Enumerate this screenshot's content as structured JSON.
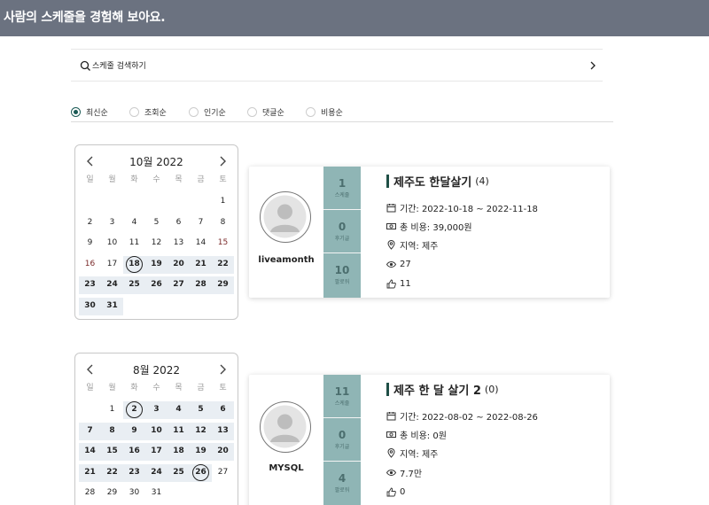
{
  "header": {
    "title": "사람의 스케줄을 경험해 보아요."
  },
  "search": {
    "placeholder": "스케줄 검색하기"
  },
  "sort_options": [
    {
      "label": "최신순",
      "selected": true
    },
    {
      "label": "조회순",
      "selected": false
    },
    {
      "label": "인기순",
      "selected": false
    },
    {
      "label": "댓글순",
      "selected": false
    },
    {
      "label": "비용순",
      "selected": false
    }
  ],
  "weekdays": [
    "일",
    "월",
    "화",
    "수",
    "목",
    "금",
    "토"
  ],
  "schedules": [
    {
      "calendar": {
        "title": "10월 2022",
        "rows": [
          [
            "",
            "",
            "",
            "",
            "",
            "",
            "1"
          ],
          [
            "2",
            "3",
            "4",
            "5",
            "6",
            "7",
            "8"
          ],
          [
            "9",
            "10",
            "11",
            "12",
            "13",
            "14",
            "15"
          ],
          [
            "16",
            "17",
            "18",
            "19",
            "20",
            "21",
            "22"
          ],
          [
            "23",
            "24",
            "25",
            "26",
            "27",
            "28",
            "29"
          ],
          [
            "30",
            "31",
            "",
            "",
            "",
            "",
            ""
          ]
        ],
        "circled": [
          "18"
        ]
      },
      "user": "liveamonth",
      "stats": [
        {
          "value": "1",
          "label": "스케줄"
        },
        {
          "value": "0",
          "label": "후기글"
        },
        {
          "value": "10",
          "label": "팔로워"
        }
      ],
      "title": "제주도 한달살기",
      "count": "(4)",
      "period": "기간: 2022-10-18 ~ 2022-11-18",
      "cost": "총 비용: 39,000원",
      "region": "지역: 제주",
      "views": "27",
      "likes": "11"
    },
    {
      "calendar": {
        "title": "8월 2022",
        "rows": [
          [
            "",
            "1",
            "2",
            "3",
            "4",
            "5",
            "6"
          ],
          [
            "7",
            "8",
            "9",
            "10",
            "11",
            "12",
            "13"
          ],
          [
            "14",
            "15",
            "16",
            "17",
            "18",
            "19",
            "20"
          ],
          [
            "21",
            "22",
            "23",
            "24",
            "25",
            "26",
            "27"
          ],
          [
            "28",
            "29",
            "30",
            "31",
            "",
            "",
            ""
          ]
        ],
        "circled": [
          "2",
          "26"
        ]
      },
      "user": "MYSQL",
      "stats": [
        {
          "value": "11",
          "label": "스케줄"
        },
        {
          "value": "0",
          "label": "후기글"
        },
        {
          "value": "4",
          "label": "팔로워"
        }
      ],
      "title": "제주 한 달 살기 2",
      "count": "(0)",
      "period": "기간: 2022-08-02 ~ 2022-08-26",
      "cost": "총 비용: 0원",
      "region": "지역: 제주",
      "views": "7.7만",
      "likes": "0"
    }
  ],
  "colors": {
    "header_bg": "#6b7280",
    "stats_bg": "#8fb5b5",
    "accent": "#1a5a55",
    "selected_range": "#e9eef3"
  }
}
